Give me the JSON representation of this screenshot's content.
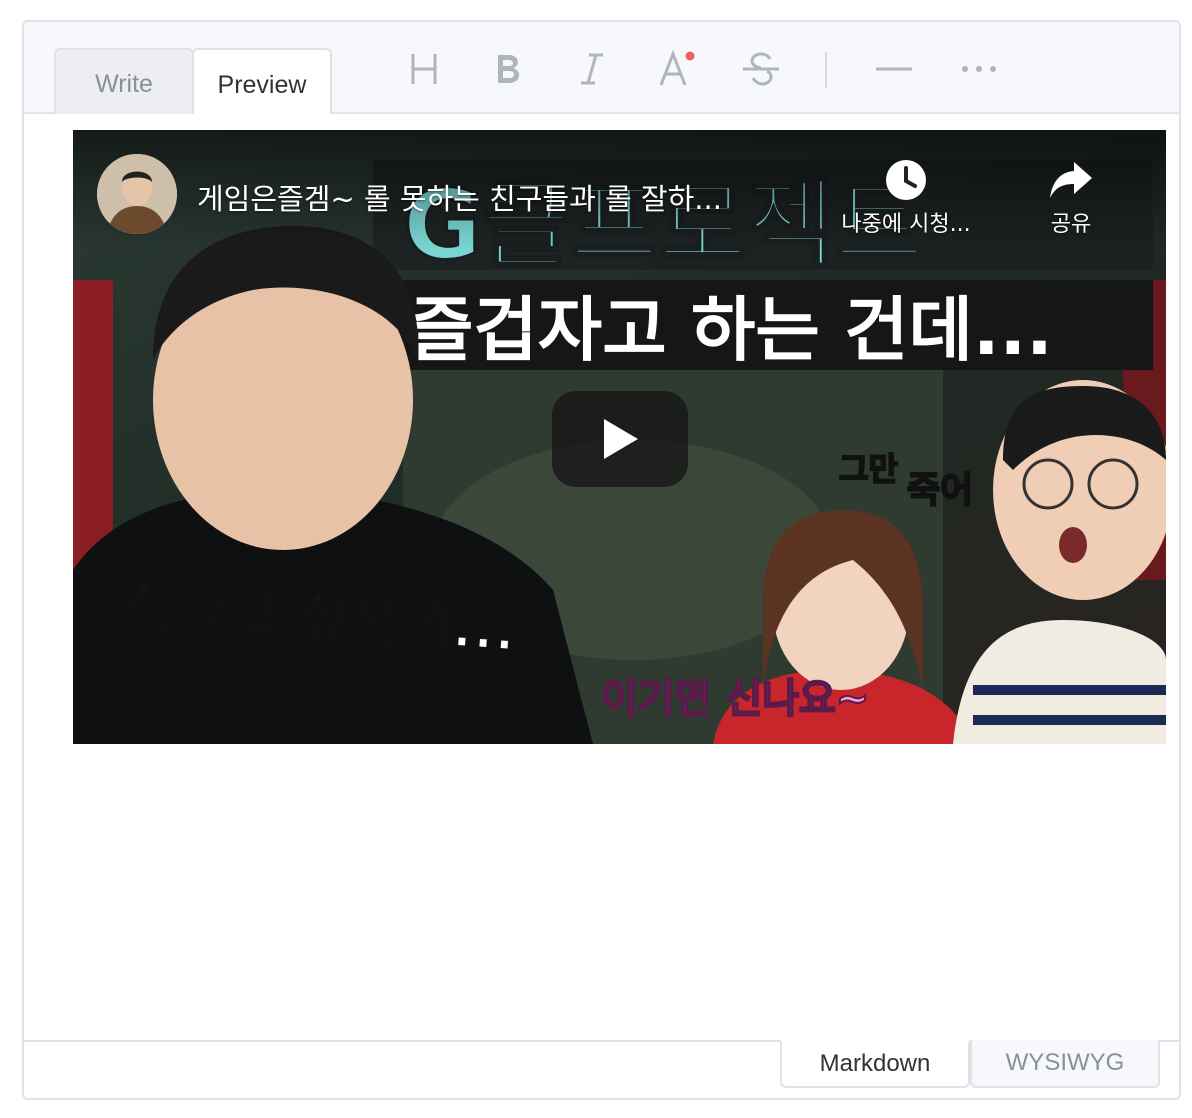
{
  "header": {
    "tabs": [
      {
        "label": "Write",
        "active": false
      },
      {
        "label": "Preview",
        "active": true
      }
    ],
    "toolbar": [
      {
        "icon": "heading-icon"
      },
      {
        "icon": "bold-icon"
      },
      {
        "icon": "italic-icon"
      },
      {
        "icon": "text-color-icon"
      },
      {
        "icon": "strikethrough-icon"
      },
      {
        "icon": "horizontal-rule-icon"
      },
      {
        "icon": "more-icon"
      }
    ]
  },
  "video": {
    "title": "게임은즐겜~ 롤 못하는 친구들과 롤 잘하...",
    "watch_later_label": "나중에 시청...",
    "share_label": "공유",
    "thumbnail_text": {
      "top_banner": "G클프로젝트",
      "headline": "즐겁자고 하는 건데...",
      "left_caption": "신나고 싶은데...",
      "bottom_caption": "이기면 신나요~",
      "right_caption_a": "그만",
      "right_caption_b": "죽어"
    }
  },
  "footer": {
    "modes": [
      {
        "label": "Markdown",
        "active": true
      },
      {
        "label": "WYSIWYG",
        "active": false
      }
    ]
  },
  "colors": {
    "accent_dot": "#f0605d",
    "border": "#dfe1e6",
    "header_bg": "#f7f8fb",
    "icon_gray": "#b0b4bb",
    "banner_teal": "#7ad6d2"
  }
}
